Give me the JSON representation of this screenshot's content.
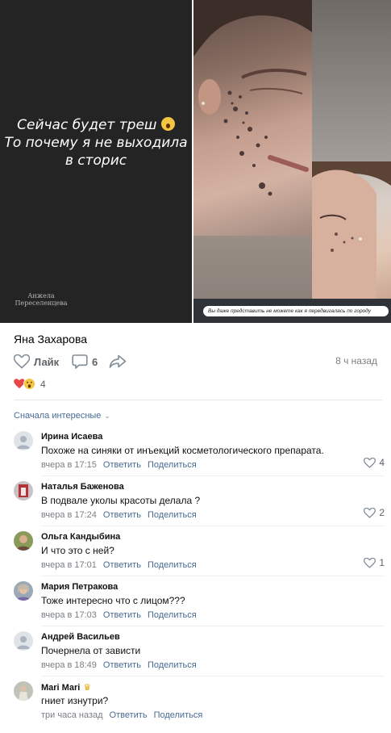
{
  "media": {
    "story_text": [
      "Сейчас будет треш",
      "То почему я не выходила",
      "в сторис"
    ],
    "watermark": [
      "Анжела",
      "Переселенцева"
    ],
    "caption": "Вы даже представить не можете как я передвигалась по городу"
  },
  "post": {
    "author": "Яна Захарова",
    "like_label": "Лайк",
    "comment_count": "6",
    "time_ago": "8 ч назад",
    "reaction_count": "4"
  },
  "sort_label": "Сначала интересные",
  "comments": [
    {
      "author": "Ирина Исаева",
      "text": "Похоже на синяки от инъекций косметологического препарата.",
      "time": "вчера в 17:15",
      "reply": "Ответить",
      "share": "Поделиться",
      "likes": "4"
    },
    {
      "author": "Наталья Баженова",
      "text": "В подвале уколы красоты делала ?",
      "time": "вчера в 17:24",
      "reply": "Ответить",
      "share": "Поделиться",
      "likes": "2"
    },
    {
      "author": "Ольга Кандыбина",
      "text": "И что это с ней?",
      "time": "вчера в 17:01",
      "reply": "Ответить",
      "share": "Поделиться",
      "likes": "1"
    },
    {
      "author": "Мария Петракова",
      "text": "Тоже интересно что с лицом???",
      "time": "вчера в 17:03",
      "reply": "Ответить",
      "share": "Поделиться",
      "likes": ""
    },
    {
      "author": "Андрей Васильев",
      "text": "Почернела от зависти",
      "time": "вчера в 18:49",
      "reply": "Ответить",
      "share": "Поделиться",
      "likes": ""
    },
    {
      "author": "Mari Mari",
      "text": "гниет изнутри?",
      "time": "три часа назад",
      "reply": "Ответить",
      "share": "Поделиться",
      "likes": ""
    }
  ],
  "colors": {
    "link": "#476a93",
    "meta": "#7a7f85",
    "heart": "#e64646"
  }
}
